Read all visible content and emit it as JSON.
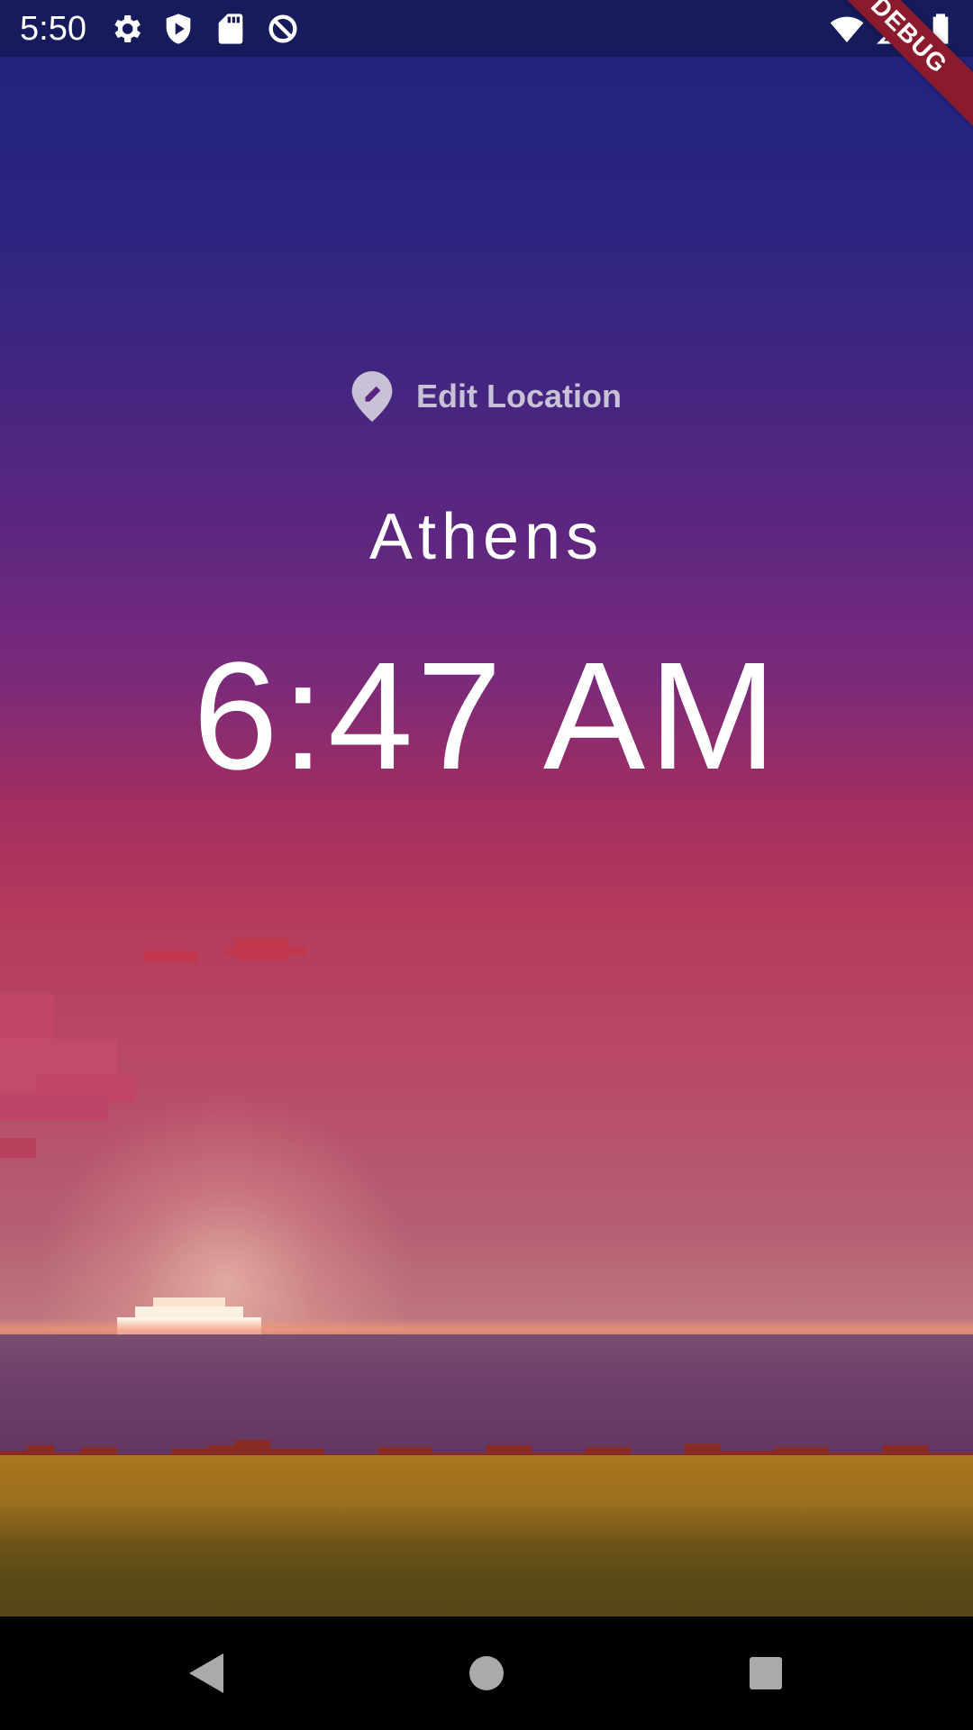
{
  "status_bar": {
    "time": "5:50",
    "icons_left": [
      "settings-icon",
      "shield-play-icon",
      "sd-card-icon",
      "data-saver-icon"
    ],
    "icons_right": [
      "wifi-icon",
      "signal-icon",
      "battery-icon"
    ]
  },
  "debug_banner": {
    "label": "DEBUG"
  },
  "location": {
    "edit_label": "Edit Location",
    "icon": "edit-location-icon"
  },
  "clock": {
    "city": "Athens",
    "time": "6:47 AM"
  },
  "colors": {
    "status_bar": "#161b5c",
    "sky_top": "#23237e",
    "sky_mid": "#a32e60",
    "horizon": "#c07a80",
    "grass": "#a8781e",
    "debug_banner": "#8b1a2c",
    "label_muted": "#c9c2d6"
  },
  "nav_bar": {
    "buttons": [
      "back",
      "home",
      "recents"
    ]
  }
}
